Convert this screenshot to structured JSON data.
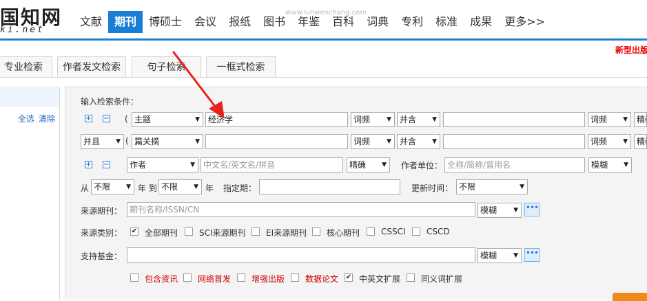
{
  "header": {
    "logo_main": "国知网",
    "logo_sub": "ki.net",
    "watermark": "www.lunwenchang.com",
    "new_pub": "新型出版",
    "nav": [
      "文献",
      "期刊",
      "博硕士",
      "会议",
      "报纸",
      "图书",
      "年鉴",
      "百科",
      "词典",
      "专利",
      "标准",
      "成果",
      "更多>>"
    ]
  },
  "tabs": [
    "专业检索",
    "作者发文检索",
    "句子检索",
    "一框式检索"
  ],
  "left": {
    "select_all": "全选",
    "clear": "清除"
  },
  "form": {
    "title": "输入检索条件：",
    "row1": {
      "paren": "(",
      "field": "主题",
      "value": "经济学",
      "match": "词频",
      "op": "并含",
      "match2": "词频",
      "match3": "精确"
    },
    "row2": {
      "logic": "并且",
      "paren": "(",
      "field": "篇关摘",
      "match": "词频",
      "op": "并含",
      "match2": "词频",
      "match3": "精确"
    },
    "row3": {
      "field": "作者",
      "placeholder": "中文名/英文名/拼音",
      "match": "精确",
      "unit_label": "作者单位：",
      "unit_placeholder": "全称/简称/曾用名",
      "unit_match": "模糊"
    },
    "row4": {
      "from": "从",
      "from_val": "不限",
      "year_to": "年 到",
      "to_val": "不限",
      "year": "年",
      "period_label": "指定期：",
      "update_label": "更新时间：",
      "update_val": "不限"
    },
    "row5": {
      "label": "来源期刊：",
      "placeholder": "期刊名称/ISSN/CN",
      "match": "模糊"
    },
    "row6": {
      "label": "来源类别：",
      "items": [
        "全部期刊",
        "SCI来源期刊",
        "EI来源期刊",
        "核心期刊",
        "CSSCI",
        "CSCD"
      ],
      "checked": [
        true,
        false,
        false,
        false,
        false,
        false
      ]
    },
    "row7": {
      "label": "支持基金：",
      "match": "模糊"
    },
    "row8": {
      "items": [
        "包含资讯",
        "网络首发",
        "增强出版",
        "数据论文",
        "中英文扩展",
        "同义词扩展"
      ],
      "checked": [
        false,
        false,
        false,
        false,
        true,
        false
      ]
    }
  },
  "icons": {
    "plus": "plus-icon",
    "minus": "minus-icon",
    "arrow": "red-annotation-arrow"
  },
  "colors": {
    "accent": "#1a7fd4",
    "red": "#c00",
    "orange": "#f08a1a"
  }
}
